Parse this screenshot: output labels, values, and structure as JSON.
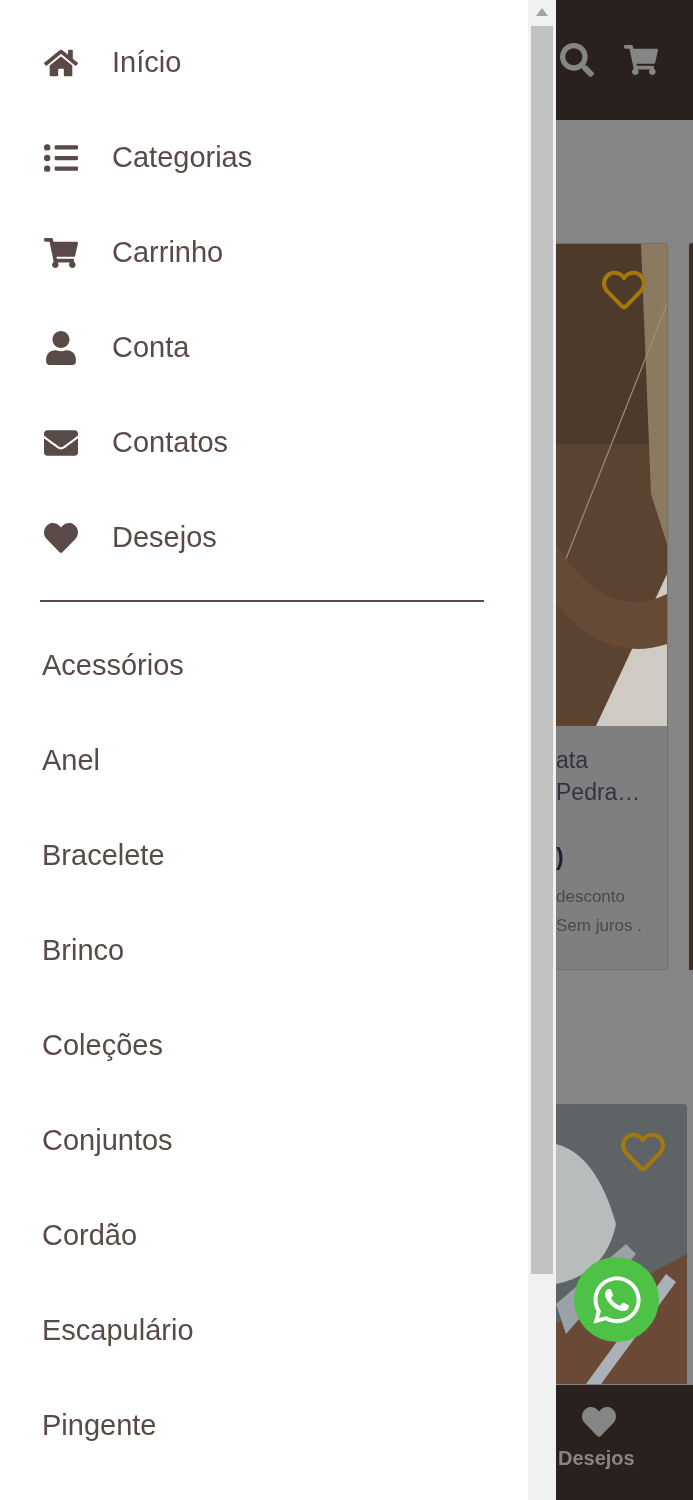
{
  "main_menu": [
    {
      "kind": "home",
      "label": "Início"
    },
    {
      "kind": "list",
      "label": "Categorias"
    },
    {
      "kind": "cart",
      "label": "Carrinho"
    },
    {
      "kind": "user",
      "label": "Conta"
    },
    {
      "kind": "envelope",
      "label": "Contatos"
    },
    {
      "kind": "heart",
      "label": "Desejos"
    }
  ],
  "categories": [
    "Acessórios",
    "Anel",
    "Bracelete",
    "Brinco",
    "Coleções",
    "Conjuntos",
    "Cordão",
    "Escapulário",
    "Pingente"
  ],
  "background_page": {
    "product_card": {
      "title_lines": [
        "ata",
        "Pedra…"
      ],
      "price": ")",
      "discount": "desconto",
      "installments": "Sem juros ."
    },
    "bottom_nav": {
      "label": "Desejos"
    }
  }
}
